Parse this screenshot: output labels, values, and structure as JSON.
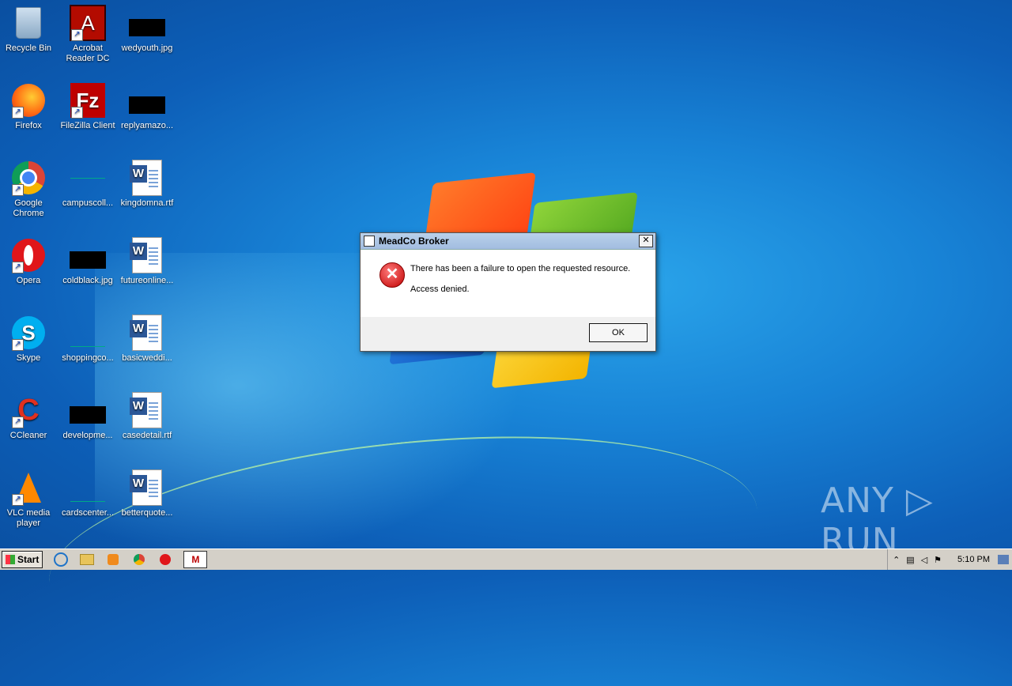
{
  "desktop": {
    "icons": [
      {
        "label": "Recycle Bin"
      },
      {
        "label": "Acrobat Reader DC"
      },
      {
        "label": "wedyouth.jpg"
      },
      {
        "label": "Firefox"
      },
      {
        "label": "FileZilla Client"
      },
      {
        "label": "replyamazo..."
      },
      {
        "label": "Google Chrome"
      },
      {
        "label": "campuscoll..."
      },
      {
        "label": "kingdomna.rtf"
      },
      {
        "label": "Opera"
      },
      {
        "label": "coldblack.jpg"
      },
      {
        "label": "futureonline..."
      },
      {
        "label": "Skype"
      },
      {
        "label": "shoppingco..."
      },
      {
        "label": "basicweddi..."
      },
      {
        "label": "CCleaner"
      },
      {
        "label": "developme..."
      },
      {
        "label": "casedetail.rtf"
      },
      {
        "label": "VLC media player"
      },
      {
        "label": "cardscenter..."
      },
      {
        "label": "betterquote..."
      }
    ]
  },
  "dialog": {
    "title": "MeadCo Broker",
    "close": "✕",
    "message": "There has been a failure to open the requested resource.",
    "detail": "Access denied.",
    "ok": "OK",
    "error_glyph": "✕"
  },
  "taskbar": {
    "start": "Start",
    "active_app": "M",
    "tray_up": "⌃",
    "clock": "5:10 PM"
  },
  "watermark": "ANY ▷ RUN",
  "colors": {
    "error": "#c00000",
    "titlebar": "#a2bde0"
  }
}
